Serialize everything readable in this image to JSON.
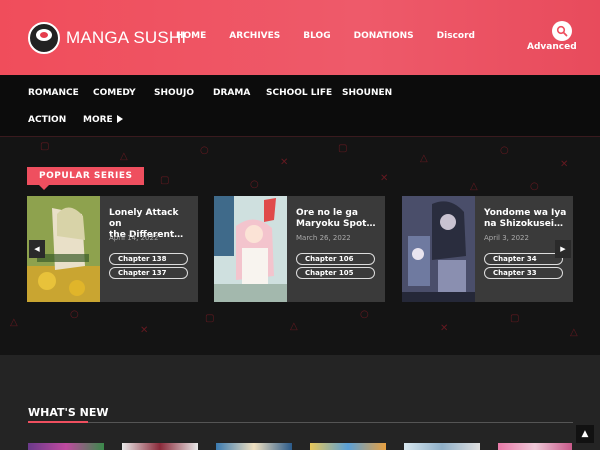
{
  "header": {
    "logo_text": "MANGA SUSHI",
    "nav": [
      "HOME",
      "ARCHIVES",
      "BLOG",
      "DONATIONS",
      "Discord"
    ],
    "advanced_label": "Advanced"
  },
  "categories": [
    "ROMANCE",
    "COMEDY",
    "SHOUJO",
    "DRAMA",
    "SCHOOL LIFE",
    "SHOUNEN",
    "ACTION",
    "MORE"
  ],
  "popular": {
    "badge": "POPULAR SERIES",
    "cards": [
      {
        "title_line1": "Lonely Attack on",
        "title_line2": "the Different…",
        "date": "April 14, 2022",
        "chapters": [
          "Chapter 138",
          "Chapter 137"
        ]
      },
      {
        "title_line1": "Ore no le ga",
        "title_line2": "Maryoku Spot…",
        "date": "March 26, 2022",
        "chapters": [
          "Chapter 106",
          "Chapter 105"
        ]
      },
      {
        "title_line1": "Yondome wa Iya",
        "title_line2": "na Shizokusei…",
        "date": "April 3, 2022",
        "chapters": [
          "Chapter 34",
          "Chapter 33"
        ]
      }
    ]
  },
  "whats_new": {
    "title": "WHAT'S NEW"
  },
  "colors": {
    "accent": "#ef4f5f",
    "header": "#f04d5b",
    "dark": "#0c0c0c"
  }
}
